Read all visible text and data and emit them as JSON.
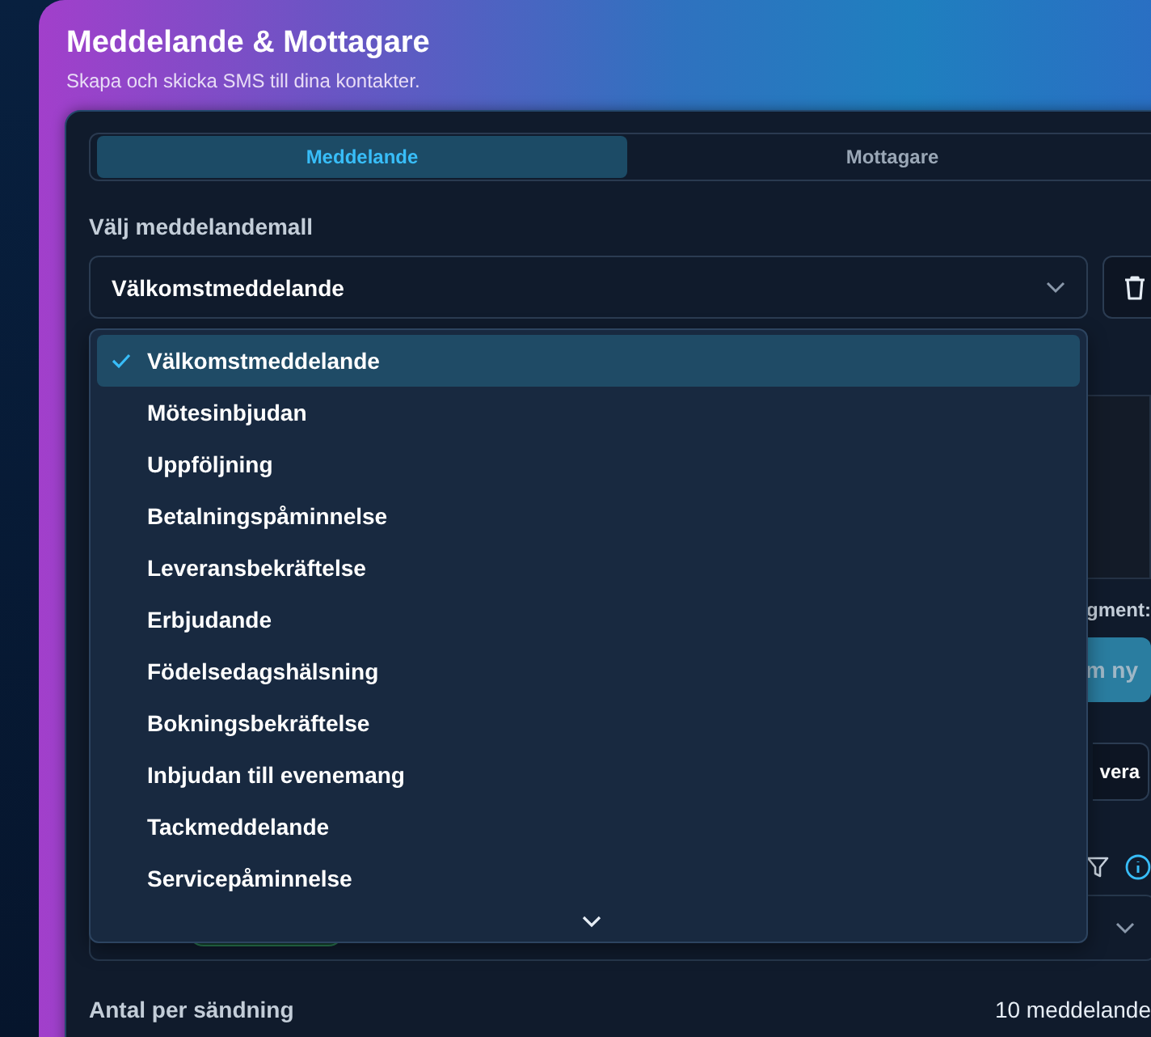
{
  "header": {
    "title": "Meddelande & Mottagare",
    "subtitle": "Skapa och skicka SMS till dina kontakter."
  },
  "tabs": [
    {
      "label": "Meddelande",
      "selected": true
    },
    {
      "label": "Mottagare",
      "selected": false
    }
  ],
  "template": {
    "label": "Välj meddelandemall",
    "value": "Välkomstmeddelande"
  },
  "template_menu": [
    {
      "label": "Välkomstmeddelande",
      "selected": true
    },
    {
      "label": "Mötesinbjudan",
      "selected": false
    },
    {
      "label": "Uppföljning",
      "selected": false
    },
    {
      "label": "Betalningspåminnelse",
      "selected": false
    },
    {
      "label": "Leveransbekräftelse",
      "selected": false
    },
    {
      "label": "Erbjudande",
      "selected": false
    },
    {
      "label": "Födelsedagshälsning",
      "selected": false
    },
    {
      "label": "Bokningsbekräftelse",
      "selected": false
    },
    {
      "label": "Inbjudan till evenemang",
      "selected": false
    },
    {
      "label": "Tackmeddelande",
      "selected": false
    },
    {
      "label": "Servicepåminnelse",
      "selected": false
    }
  ],
  "covered": {
    "segment_label": "gment:",
    "primary_button": "m ny",
    "secondary_button": "vera"
  },
  "send_batch": {
    "label": "Antal per sändning",
    "value": "10 meddelande"
  }
}
